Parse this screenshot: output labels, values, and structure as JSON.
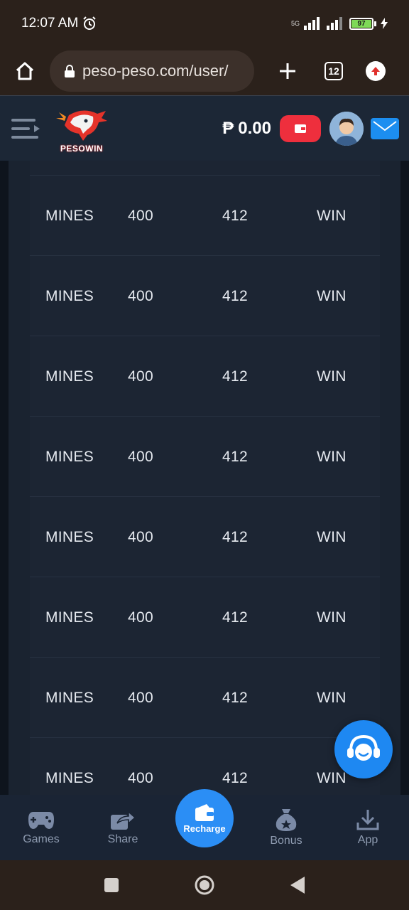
{
  "status_bar": {
    "time": "12:07 AM",
    "network_label": "5G",
    "battery_level": "97"
  },
  "browser": {
    "url": "peso-peso.com/user/",
    "tabs_count": "12"
  },
  "header": {
    "logo_text": "PESOWIN",
    "currency_symbol": "₱",
    "balance": "0.00"
  },
  "history": {
    "rows": [
      {
        "game": "MINES",
        "bet": "400",
        "payout": "412",
        "result": "WIN"
      },
      {
        "game": "MINES",
        "bet": "400",
        "payout": "412",
        "result": "WIN"
      },
      {
        "game": "MINES",
        "bet": "400",
        "payout": "412",
        "result": "WIN"
      },
      {
        "game": "MINES",
        "bet": "400",
        "payout": "412",
        "result": "WIN"
      },
      {
        "game": "MINES",
        "bet": "400",
        "payout": "412",
        "result": "WIN"
      },
      {
        "game": "MINES",
        "bet": "400",
        "payout": "412",
        "result": "WIN"
      },
      {
        "game": "MINES",
        "bet": "400",
        "payout": "412",
        "result": "WIN"
      },
      {
        "game": "MINES",
        "bet": "400",
        "payout": "412",
        "result": "WIN"
      }
    ]
  },
  "bottom_nav": {
    "games": "Games",
    "share": "Share",
    "recharge": "Recharge",
    "bonus": "Bonus",
    "app": "App"
  },
  "colors": {
    "accent_blue": "#1e88f2",
    "wallet_red": "#ee2f3d",
    "table_bg": "#1c2533",
    "header_bg": "#1c2736"
  }
}
